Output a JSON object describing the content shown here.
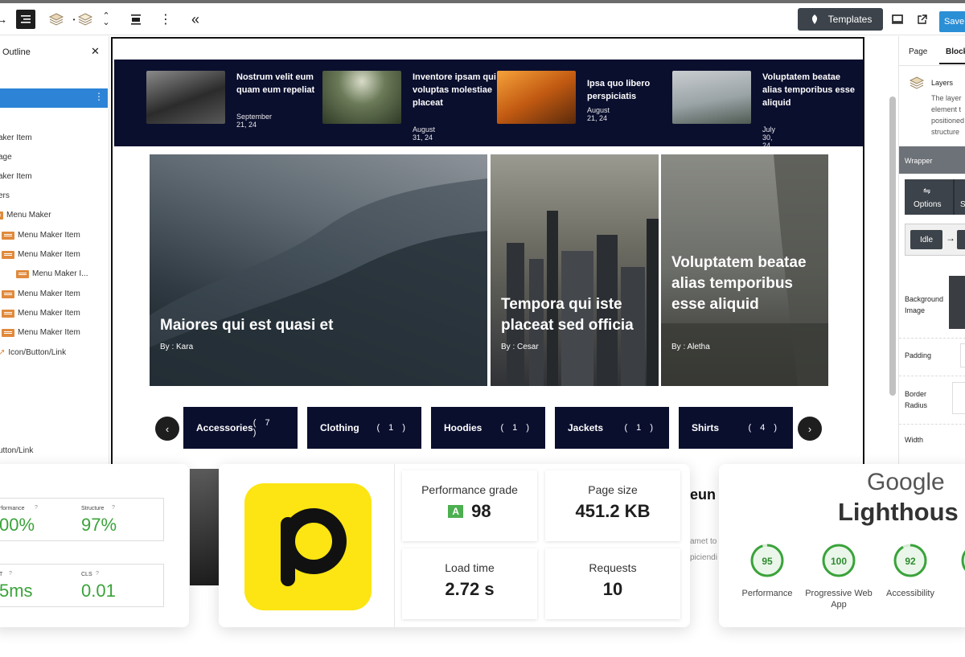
{
  "toolbar": {
    "templates_label": "Templates",
    "save_label": "Save"
  },
  "outline": {
    "title": "Outline",
    "items": [
      {
        "label": "aker Item"
      },
      {
        "label": "age"
      },
      {
        "label": "aker Item"
      },
      {
        "label": "ers"
      },
      {
        "label": "Menu Maker"
      },
      {
        "label": "Menu Maker Item"
      },
      {
        "label": "Menu Maker Item"
      },
      {
        "label": "Menu Maker I..."
      },
      {
        "label": "Menu Maker Item"
      },
      {
        "label": "Menu Maker Item"
      },
      {
        "label": "Menu Maker Item"
      },
      {
        "label": "Icon/Button/Link"
      },
      {
        "label": "utton/Link"
      }
    ]
  },
  "posts": [
    {
      "title": "Nostrum velit eum quam eum repeliat",
      "date": "September 21, 24"
    },
    {
      "title": "Inventore ipsam qui voluptas molestiae placeat",
      "date": "August 31, 24"
    },
    {
      "title": "Ipsa quo libero perspiciatis",
      "date": "August 21, 24"
    },
    {
      "title": "Voluptatem beatae alias temporibus esse aliquid",
      "date": "July 30, 24"
    }
  ],
  "heroes": [
    {
      "title": "Maiores qui est quasi et",
      "byline": "By : Kara"
    },
    {
      "title": "Tempora qui iste placeat sed officia",
      "byline": "By : Cesar"
    },
    {
      "title": "Voluptatem beatae alias temporibus esse aliquid",
      "byline": "By : Aletha"
    }
  ],
  "categories": [
    {
      "name": "Accessories",
      "count": "( 7 )"
    },
    {
      "name": "Clothing",
      "count": "( 1 )"
    },
    {
      "name": "Hoodies",
      "count": "( 1 )"
    },
    {
      "name": "Jackets",
      "count": "( 1 )"
    },
    {
      "name": "Shirts",
      "count": "( 4 )"
    }
  ],
  "right_panel": {
    "tab_page": "Page",
    "tab_block": "Block",
    "layers_title": "Layers",
    "layers_desc_1": "The layer",
    "layers_desc_2": "element t",
    "layers_desc_3": "positioned",
    "layers_desc_4": "structure",
    "wrapper": "Wrapper",
    "options": "Options",
    "options_s": "S",
    "idle": "Idle",
    "background_image": "Background Image",
    "padding": "Padding",
    "border_radius": "Border Radius",
    "width": "Width"
  },
  "gtmetrix": {
    "performance_label": "rformance",
    "performance_value": "00%",
    "structure_label": "Structure",
    "structure_value": "97%",
    "lcp_label": "T",
    "lcp_value": "5ms",
    "cls_label": "CLS",
    "cls_value": "0.01"
  },
  "pingdom": {
    "grade_label": "Performance grade",
    "grade_letter": "A",
    "grade_value": "98",
    "page_size_label": "Page size",
    "page_size_value": "451.2 KB",
    "load_time_label": "Load time",
    "load_time_value": "2.72 s",
    "requests_label": "Requests",
    "requests_value": "10"
  },
  "middle_snippet": {
    "heading": "eun",
    "line1": "amet to",
    "line2": "piciendi"
  },
  "lighthouse": {
    "brand_top": "Google",
    "brand_bottom": "Lighthous",
    "scores": [
      {
        "value": "95",
        "label": "Performance",
        "fraction": 0.95
      },
      {
        "value": "100",
        "label": "Progressive Web App",
        "fraction": 1.0
      },
      {
        "value": "92",
        "label": "Accessibility",
        "fraction": 0.92
      }
    ]
  },
  "colors": {
    "accent_blue": "#2d84d6",
    "navy": "#0b0f2e",
    "score_green": "#3aa33a",
    "pingdom_yellow": "#fce512"
  }
}
